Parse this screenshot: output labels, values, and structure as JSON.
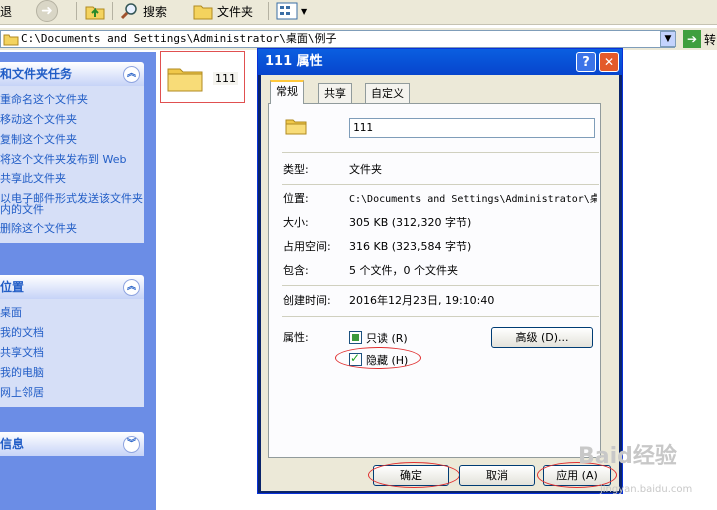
{
  "toolbar": {
    "back_fragment": "退",
    "search_label": "搜索",
    "folders_label": "文件夹"
  },
  "address": {
    "path": "C:\\Documents and Settings\\Administrator\\桌面\\例子",
    "go_label": "转"
  },
  "sidebar": {
    "tasks": {
      "title": "和文件夹任务",
      "items": [
        "重命名这个文件夹",
        "移动这个文件夹",
        "复制这个文件夹",
        "将这个文件夹发布到 Web",
        "共享此文件夹",
        "以电子邮件形式发送该文件夹内的文件",
        "删除这个文件夹"
      ]
    },
    "places": {
      "title": "位置",
      "items": [
        "桌面",
        "我的文档",
        "共享文档",
        "我的电脑",
        "网上邻居"
      ]
    },
    "details": {
      "title": "信息"
    }
  },
  "folder": {
    "name": "111"
  },
  "dialog": {
    "title": "111 属性",
    "tabs": [
      "常规",
      "共享",
      "自定义"
    ],
    "name_value": "111",
    "type_label": "类型:",
    "type_value": "文件夹",
    "location_label": "位置:",
    "location_value": "C:\\Documents and Settings\\Administrator\\桌",
    "size_label": "大小:",
    "size_value": "305 KB (312,320 字节)",
    "size_on_disk_label": "占用空间:",
    "size_on_disk_value": "316 KB (323,584 字节)",
    "contains_label": "包含:",
    "contains_value": "5 个文件，0 个文件夹",
    "created_label": "创建时间:",
    "created_value": "2016年12月23日, 19:10:40",
    "attributes_label": "属性:",
    "readonly_label": "只读 (R)",
    "readonly_state": "indeterminate",
    "hidden_label": "隐藏 (H)",
    "hidden_state": "checked",
    "advanced_label": "高级 (D)...",
    "ok_label": "确定",
    "cancel_label": "取消",
    "apply_label": "应用 (A)"
  },
  "watermark": {
    "text": "Baid经验",
    "sub": "jingyan.baidu.com"
  },
  "colors": {
    "title_bar": "#0a5fe0",
    "sidebar_bg": "#6b8de6",
    "annotation": "#e03030"
  }
}
